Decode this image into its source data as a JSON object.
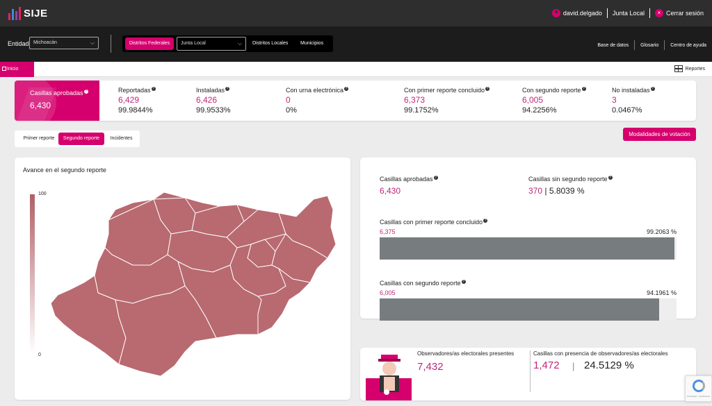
{
  "app": {
    "title": "SIJE",
    "logo_bar_colors": [
      "#e91e63",
      "#3f8bd8",
      "#8e44ad",
      "#e91e63"
    ]
  },
  "user": {
    "name": "david.delgado",
    "role": "Junta Local",
    "logout": "Cerrar sesión"
  },
  "filters": {
    "entidad_label": "Entidad",
    "entidad_value": "Michoacán",
    "tabs": [
      "Distritos Federales",
      "Distritos Locales",
      "Municipios"
    ],
    "junta_value": "Junta Local",
    "links": [
      "Base de datos",
      "Glosario",
      "Centro de ayuda"
    ]
  },
  "breadcrumb": {
    "home": "Inicio",
    "reportes": "Reportes"
  },
  "stats": {
    "aprobadas": {
      "label": "Casillas aprobadas",
      "value": "6,430"
    },
    "items": [
      {
        "label": "Reportadas",
        "value": "6,429",
        "pct": "99.9844%"
      },
      {
        "label": "Instaladas",
        "value": "6,426",
        "pct": "99.9533%"
      },
      {
        "label": "Con urna electrónica",
        "value": "0",
        "pct": "0%"
      },
      {
        "label": "Con primer reporte concluido",
        "value": "6,373",
        "pct": "99.1752%"
      },
      {
        "label": "Con segundo reporte",
        "value": "6,005",
        "pct": "94.2256%"
      },
      {
        "label": "No instaladas",
        "value": "3",
        "pct": "0.0467%"
      }
    ]
  },
  "report_tabs": [
    "Primer reporte",
    "Segundo reporte",
    "Incidentes"
  ],
  "modalidades": "Modalidades de votación",
  "map": {
    "title": "Avance en el segundo reporte",
    "legend_max": "100",
    "legend_min": "0",
    "fill": "#b86a70"
  },
  "progress": {
    "aprobadas_label": "Casillas aprobadas",
    "aprobadas_value": "6,430",
    "sin_segundo_label": "Casillas sin segundo reporte",
    "sin_segundo_value": "370",
    "sin_segundo_pct": "| 5.8039 %",
    "primer_label": "Casillas con primer reporte concluido",
    "primer_value": "6,375",
    "primer_pct_text": "99.2063 %",
    "primer_pct": 99.2063,
    "segundo_label": "Casillas con segundo reporte",
    "segundo_value": "6,005",
    "segundo_pct_text": "94.1961 %",
    "segundo_pct": 94.1961
  },
  "observers": {
    "presentes_label": "Observadores/as electorales presentes",
    "presentes_value": "7,432",
    "casillas_label": "Casillas con presencia de observadores/as electorales",
    "casillas_value": "1,472",
    "separator": "|",
    "casillas_pct": "24.5129 %"
  },
  "recaptcha_text": "Privacidad - Condiciones",
  "accent": "#d5006d"
}
